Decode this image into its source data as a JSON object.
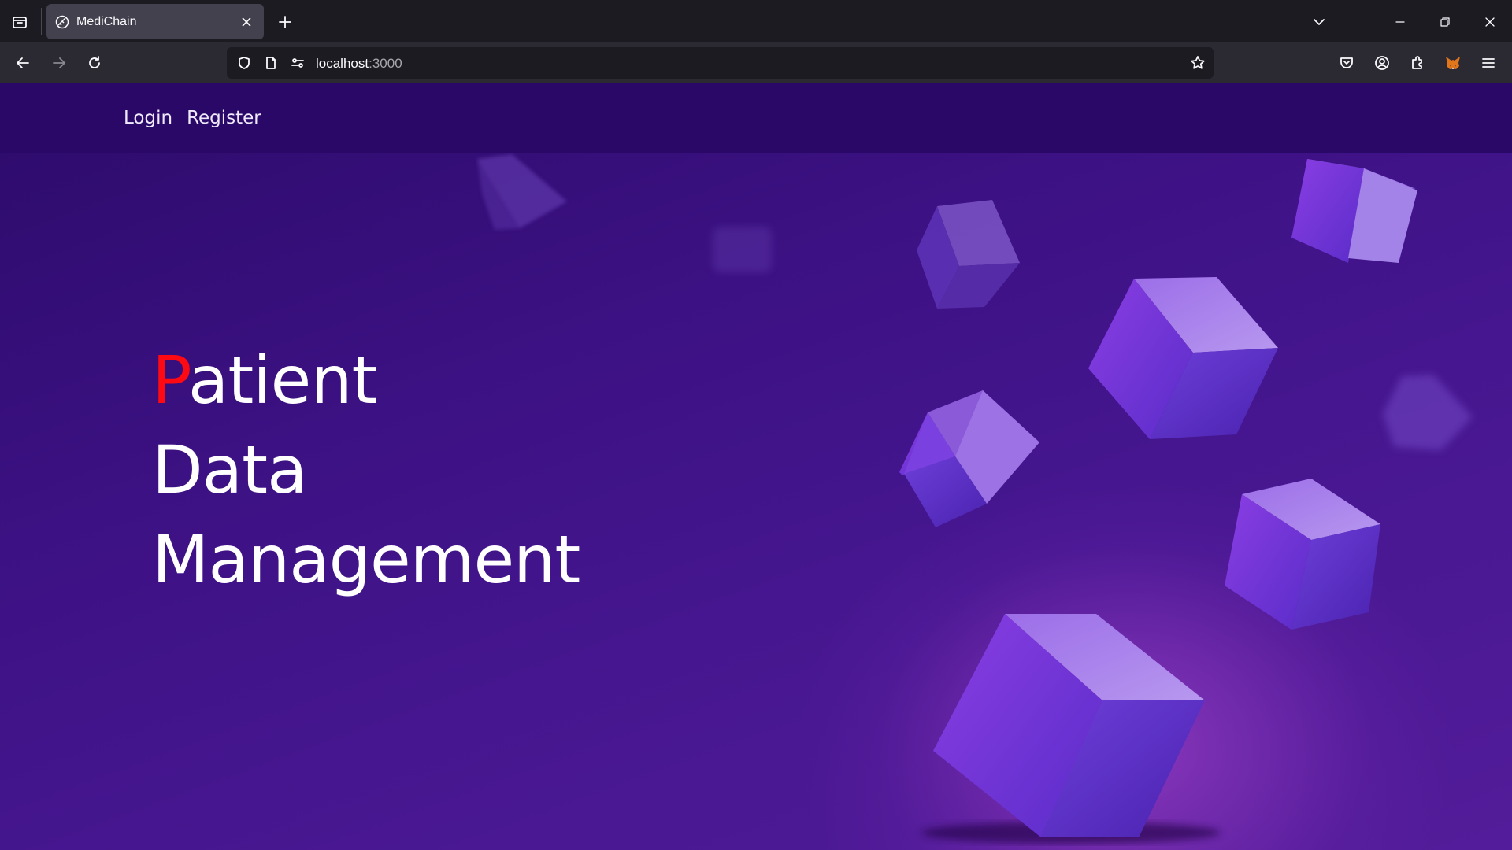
{
  "browser": {
    "tab": {
      "title": "MediChain"
    },
    "url": {
      "host": "localhost",
      "port": ":3000"
    }
  },
  "site": {
    "nav": [
      {
        "label": "Login"
      },
      {
        "label": "Register"
      }
    ],
    "hero": {
      "accent_letter": "P",
      "line1_rest": "atient",
      "line2": "Data",
      "line3": "Management"
    }
  },
  "colors": {
    "accent": "#ff0a12",
    "nav_bg": "#2a0868",
    "page_bg": "#3c1183"
  },
  "icons": {
    "tabbar": [
      "tab-list-icon",
      "new-tab-icon",
      "list-all-tabs-icon",
      "minimize-icon",
      "restore-icon",
      "close-window-icon"
    ],
    "toolbar": [
      "back-icon",
      "forward-icon",
      "reload-icon",
      "shield-icon",
      "page-icon",
      "permissions-icon",
      "bookmark-star-icon",
      "pocket-icon",
      "account-icon",
      "extensions-icon",
      "metamask-fox-icon",
      "menu-icon"
    ]
  }
}
